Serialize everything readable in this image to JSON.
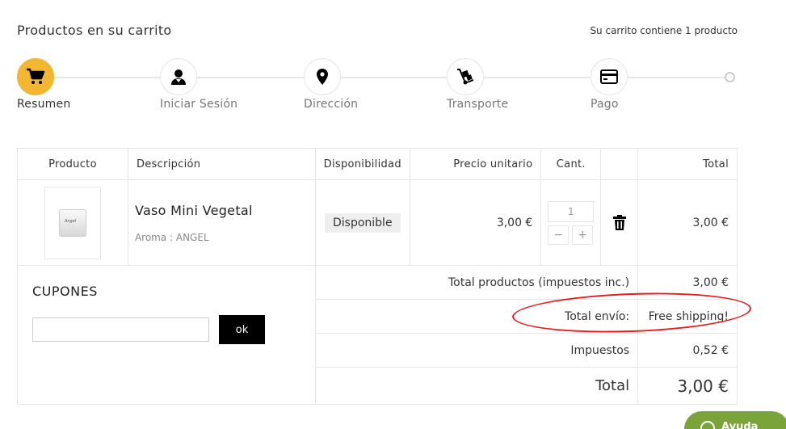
{
  "header": {
    "title": "Productos en su carrito",
    "cart_count": "Su carrito contiene 1 producto"
  },
  "steps": [
    {
      "label": "Resumen",
      "icon": "cart-icon",
      "active": true
    },
    {
      "label": "Iniciar Sesión",
      "icon": "user-icon",
      "active": false
    },
    {
      "label": "Dirección",
      "icon": "map-pin-icon",
      "active": false
    },
    {
      "label": "Transporte",
      "icon": "hand-truck-icon",
      "active": false
    },
    {
      "label": "Pago",
      "icon": "credit-card-icon",
      "active": false
    }
  ],
  "table": {
    "headers": [
      "Producto",
      "Descripción",
      "Disponibilidad",
      "Precio unitario",
      "Cant.",
      "",
      "Total"
    ],
    "product": {
      "name": "Vaso Mini Vegetal",
      "attribute": "Aroma : ANGEL",
      "image_label": "Angel",
      "availability": "Disponible",
      "unit_price": "3,00 €",
      "quantity": "1",
      "minus": "−",
      "plus": "+",
      "total": "3,00 €"
    }
  },
  "coupons": {
    "title": "CUPONES",
    "input_value": "",
    "ok_label": "ok"
  },
  "summary": {
    "products_label": "Total productos (impuestos inc.)",
    "products_value": "3,00 €",
    "shipping_label": "Total envío:",
    "shipping_value": "Free shipping!",
    "tax_label": "Impuestos",
    "tax_value": "0,52 €",
    "total_label": "Total",
    "total_value": "3,00 €"
  },
  "help": {
    "label": "Ayuda"
  },
  "colors": {
    "accent": "#f3b632",
    "annotation": "#e81c1c",
    "help_button": "#7aa33a"
  }
}
